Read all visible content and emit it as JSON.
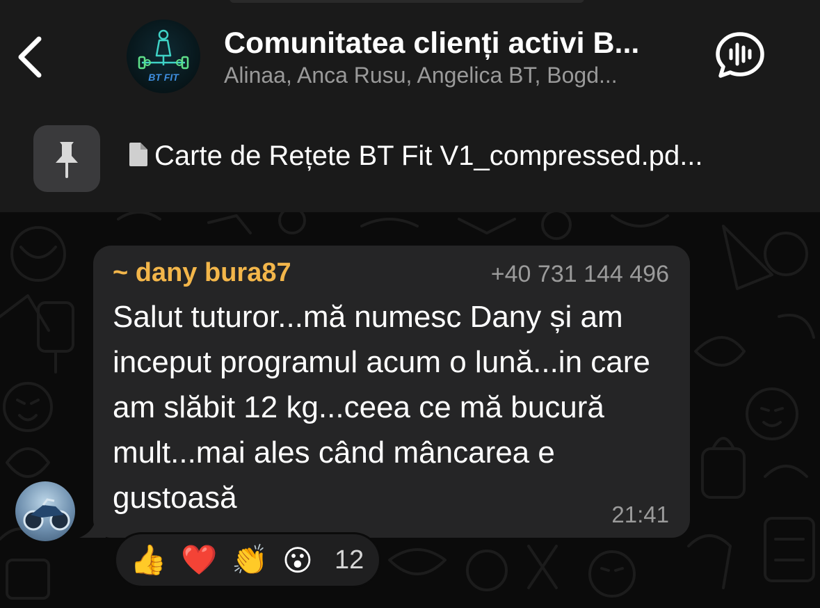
{
  "header": {
    "back_label": "Back",
    "group_title": "Comunitatea clienți activi B...",
    "group_members": "Alinaa, Anca Rusu, Angelica BT, Bogd...",
    "group_avatar_text": "BT FIT"
  },
  "pinned": {
    "text": "Carte de Rețete BT Fit V1_compressed.pd..."
  },
  "message": {
    "sender_name": "~ dany bura87",
    "sender_phone": "+40 731 144 496",
    "text": "Salut tuturor...mă numesc Dany și am inceput programul acum o lună...in care am slăbit 12 kg...ceea ce mă bucură mult...mai ales când mâncarea e gustoasă",
    "time": "21:41",
    "reactions": [
      {
        "emoji": "👍",
        "name": "thumbs-up"
      },
      {
        "emoji": "❤️",
        "name": "red-heart"
      },
      {
        "emoji": "👏",
        "name": "clapping-hands"
      },
      {
        "emoji": "😮",
        "name": "surprised-face"
      }
    ],
    "reaction_count": "12"
  },
  "colors": {
    "header_bg": "#1a1a1a",
    "chat_bg": "#0b0b0b",
    "bubble_bg": "#252526",
    "sender_name": "#f3b64a",
    "secondary_text": "#9b9b9b"
  }
}
